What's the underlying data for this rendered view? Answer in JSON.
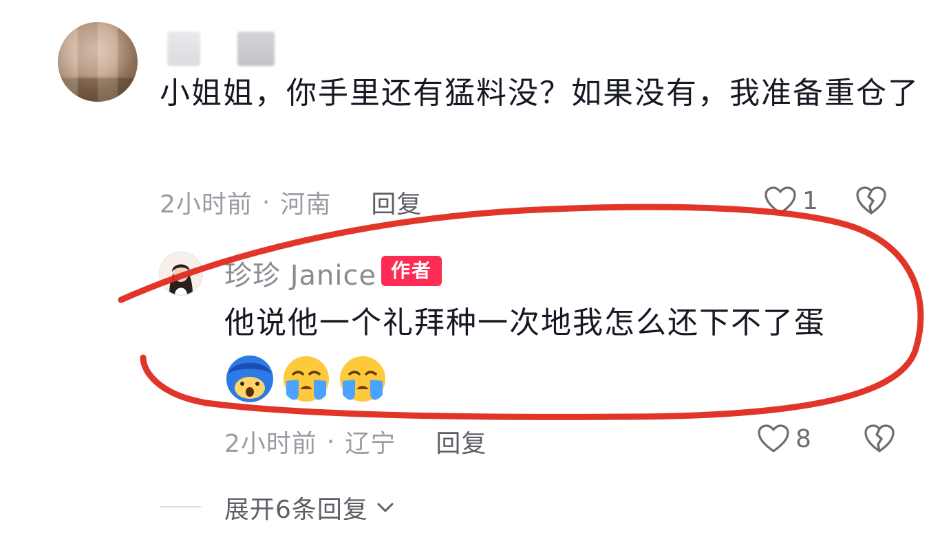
{
  "comment": {
    "text": "小姐姐，你手里还有猛料没？如果没有，我准备重仓了",
    "time": "2小时前",
    "location": "河南",
    "reply_label": "回复",
    "like_count": "1"
  },
  "reply": {
    "username": "珍珍 Janice",
    "badge": "作者",
    "text": "他说他一个礼拜种一次地我怎么还下不了蛋",
    "emojis": [
      "scared-face-emoji",
      "crying-face-emoji",
      "crying-face-emoji"
    ],
    "time": "2小时前",
    "location": "辽宁",
    "reply_label": "回复",
    "like_count": "8"
  },
  "expand": {
    "label": "展开6条回复"
  },
  "colors": {
    "author_badge": "#fe2c55",
    "annotation_stroke": "#e02a1e",
    "meta_text": "#9b9ba3"
  }
}
